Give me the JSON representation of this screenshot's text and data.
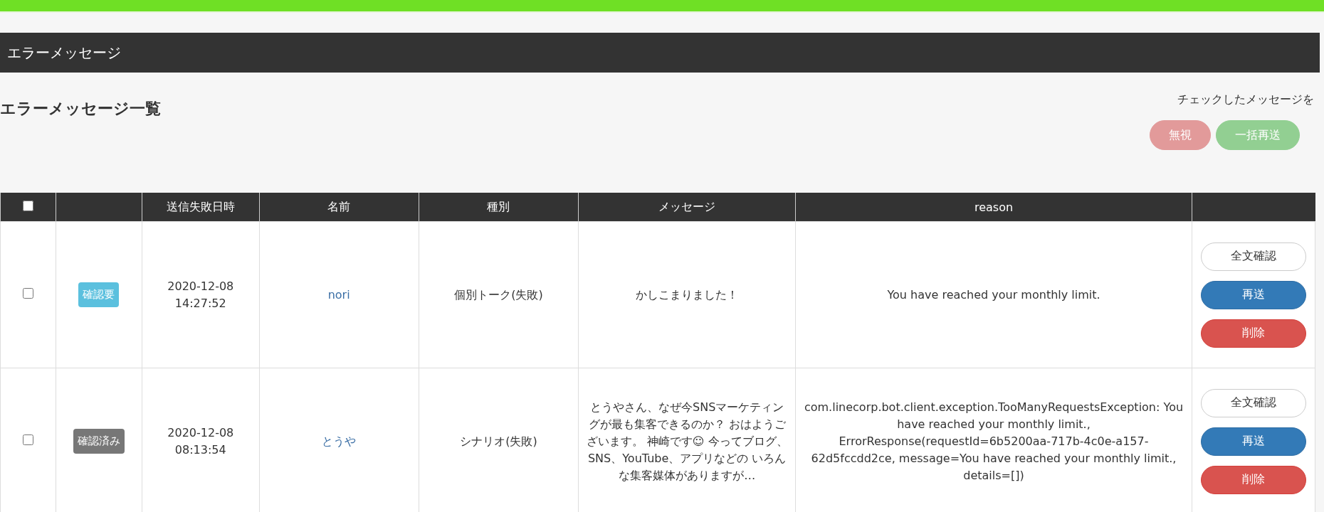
{
  "header_bar": {
    "title": "エラーメッセージ"
  },
  "page_title": "エラーメッセージ一覧",
  "bulk_actions": {
    "label": "チェックしたメッセージを",
    "buttons": [
      {
        "label": "無視",
        "kind": "ignore"
      },
      {
        "label": "一括再送",
        "kind": "resend"
      }
    ]
  },
  "table": {
    "select_all": {
      "checked": false
    },
    "columns": [
      "送信失敗日時",
      "名前",
      "種別",
      "メッセージ",
      "reason"
    ],
    "rows": [
      {
        "checked": false,
        "status": {
          "label": "確認要",
          "color": "#5bc0de"
        },
        "date": "2020-12-08",
        "time": "14:27:52",
        "name": "nori",
        "type": "個別トーク(失敗)",
        "message": "かしこまりました！",
        "reason": "You have reached your monthly limit.",
        "actions": [
          {
            "label": "全文確認",
            "kind": "view"
          },
          {
            "label": "再送",
            "kind": "resend"
          },
          {
            "label": "削除",
            "kind": "delete"
          }
        ]
      },
      {
        "checked": false,
        "status": {
          "label": "確認済み",
          "color": "#777777"
        },
        "date": "2020-12-08",
        "time": "08:13:54",
        "name": "とうや",
        "type": "シナリオ(失敗)",
        "message": "とうやさん、なぜ今SNSマーケティングが最も集客できるのか？ おはようございます。 神崎です☺ 今ってブログ、SNS、YouTube、アプリなどの いろんな集客媒体がありますが…",
        "reason": "com.linecorp.bot.client.exception.TooManyRequestsException: You have reached your monthly limit., ErrorResponse(requestId=6b5200aa-717b-4c0e-a157-62d5fccdd2ce, message=You have reached your monthly limit., details=[])",
        "actions": [
          {
            "label": "全文確認",
            "kind": "view"
          },
          {
            "label": "再送",
            "kind": "resend"
          },
          {
            "label": "削除",
            "kind": "delete"
          }
        ]
      }
    ]
  }
}
